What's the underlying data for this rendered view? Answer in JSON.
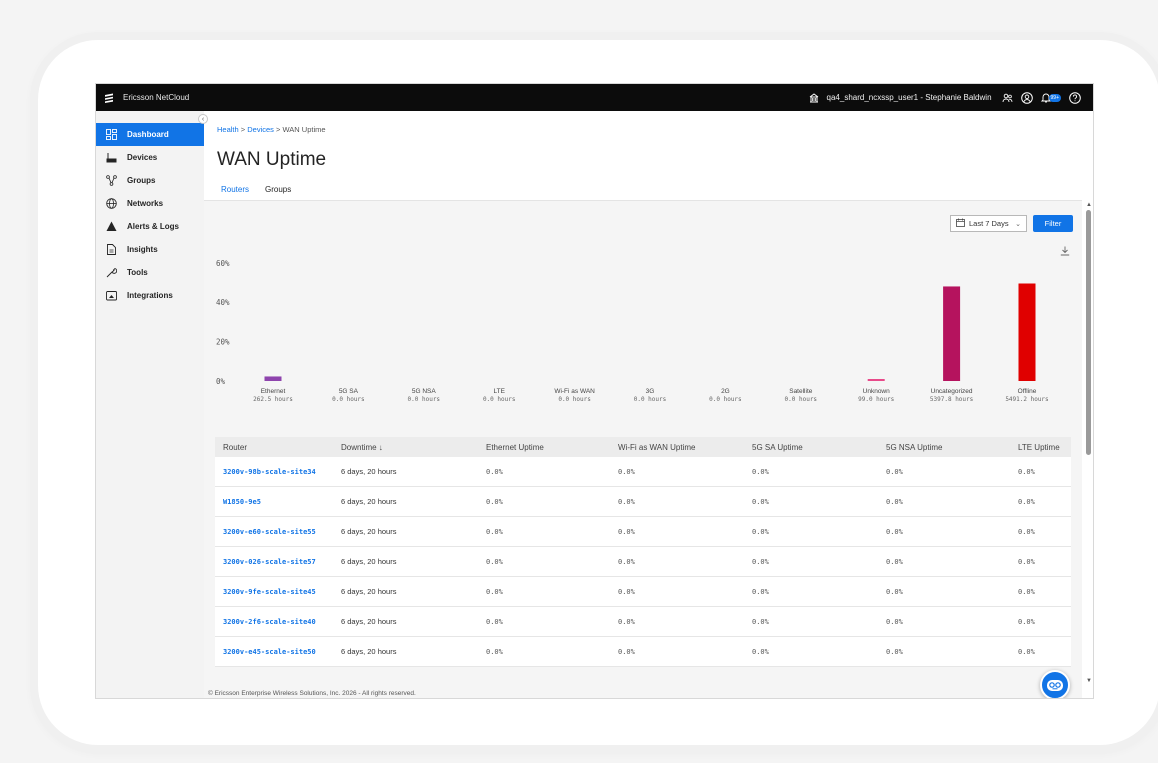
{
  "topbar": {
    "brand": "Ericsson NetCloud",
    "org": "qa4_shard_ncxssp_user1 - Stephanie Baldwin",
    "notification_badge": "99+"
  },
  "sidebar": {
    "items": [
      {
        "label": "Dashboard",
        "icon": "dashboard-icon",
        "active": true
      },
      {
        "label": "Devices",
        "icon": "devices-icon"
      },
      {
        "label": "Groups",
        "icon": "groups-icon"
      },
      {
        "label": "Networks",
        "icon": "globe-icon"
      },
      {
        "label": "Alerts & Logs",
        "icon": "warning-icon"
      },
      {
        "label": "Insights",
        "icon": "insights-icon"
      },
      {
        "label": "Tools",
        "icon": "wrench-icon"
      },
      {
        "label": "Integrations",
        "icon": "integrations-icon"
      }
    ]
  },
  "breadcrumb": {
    "health": "Health",
    "sep": " > ",
    "devices": "Devices",
    "current": "WAN Uptime"
  },
  "page": {
    "title": "WAN Uptime"
  },
  "tabs": [
    {
      "label": "Routers",
      "active": true
    },
    {
      "label": "Groups"
    }
  ],
  "controls": {
    "date_range": "Last 7 Days",
    "filter_label": "Filter"
  },
  "chart_data": {
    "type": "bar",
    "ylim": [
      0,
      66
    ],
    "yticks": [
      "0%",
      "20%",
      "40%",
      "60%"
    ],
    "ytick_values": [
      0,
      20,
      40,
      60
    ],
    "categories": [
      "Ethernet",
      "5G SA",
      "5G NSA",
      "LTE",
      "Wi-Fi as WAN",
      "3G",
      "2G",
      "Satellite",
      "Unknown",
      "Uncategorized",
      "Offline"
    ],
    "sublabels": [
      "262.5 hours",
      "0.0 hours",
      "0.0 hours",
      "0.0 hours",
      "0.0 hours",
      "0.0 hours",
      "0.0 hours",
      "0.0 hours",
      "99.0 hours",
      "5397.8 hours",
      "5491.2 hours"
    ],
    "values": [
      2.3,
      0,
      0,
      0,
      0,
      0,
      0,
      0,
      0.9,
      48.0,
      49.5
    ],
    "colors": [
      "#8e44ad",
      "#1174e6",
      "#1174e6",
      "#1174e6",
      "#1174e6",
      "#1174e6",
      "#1174e6",
      "#1174e6",
      "#e84a8a",
      "#b5135e",
      "#e00000"
    ]
  },
  "table": {
    "headers": [
      "Router",
      "Downtime ↓",
      "Ethernet Uptime",
      "Wi-Fi as WAN Uptime",
      "5G SA Uptime",
      "5G NSA Uptime",
      "LTE Uptime"
    ],
    "rows": [
      [
        "3200v-98b-scale-site34",
        "6 days, 20 hours",
        "0.0%",
        "0.0%",
        "0.0%",
        "0.0%",
        "0.0%"
      ],
      [
        "W1850-9e5",
        "6 days, 20 hours",
        "0.0%",
        "0.0%",
        "0.0%",
        "0.0%",
        "0.0%"
      ],
      [
        "3200v-e60-scale-site55",
        "6 days, 20 hours",
        "0.0%",
        "0.0%",
        "0.0%",
        "0.0%",
        "0.0%"
      ],
      [
        "3200v-026-scale-site57",
        "6 days, 20 hours",
        "0.0%",
        "0.0%",
        "0.0%",
        "0.0%",
        "0.0%"
      ],
      [
        "3200v-9fe-scale-site45",
        "6 days, 20 hours",
        "0.0%",
        "0.0%",
        "0.0%",
        "0.0%",
        "0.0%"
      ],
      [
        "3200v-2f6-scale-site40",
        "6 days, 20 hours",
        "0.0%",
        "0.0%",
        "0.0%",
        "0.0%",
        "0.0%"
      ],
      [
        "3200v-e45-scale-site50",
        "6 days, 20 hours",
        "0.0%",
        "0.0%",
        "0.0%",
        "0.0%",
        "0.0%"
      ]
    ]
  },
  "footer": {
    "text": "© Ericsson Enterprise Wireless Solutions, Inc. 2026 - All rights reserved."
  }
}
